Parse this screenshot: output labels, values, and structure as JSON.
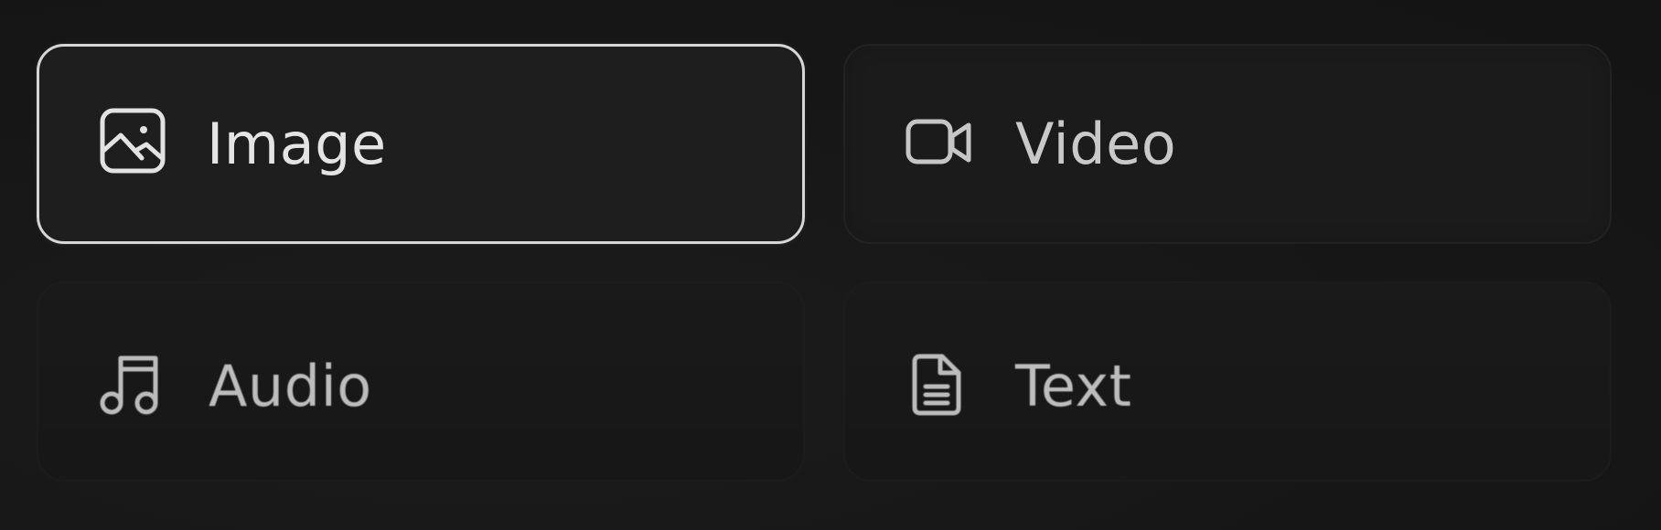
{
  "options": [
    {
      "label": "Image",
      "icon": "image-icon",
      "selected": true
    },
    {
      "label": "Video",
      "icon": "video-icon",
      "selected": false
    },
    {
      "label": "Audio",
      "icon": "music-note-icon",
      "selected": false
    },
    {
      "label": "Text",
      "icon": "document-icon",
      "selected": false
    }
  ],
  "colors": {
    "background": "#171717",
    "card_background": "#1e1e1e",
    "selected_border": "#d6d6d6",
    "text_primary": "#e4e4e4",
    "text_secondary": "#bdbdbd"
  }
}
